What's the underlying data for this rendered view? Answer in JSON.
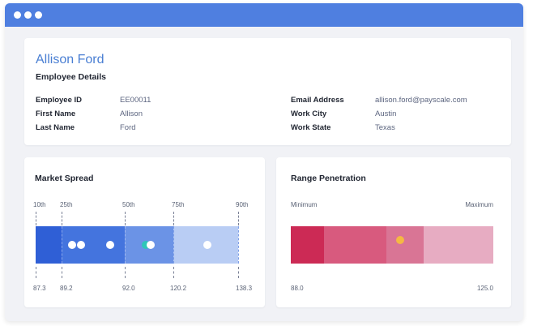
{
  "window": {
    "controls": [
      "dot",
      "dot",
      "dot"
    ]
  },
  "employee": {
    "name": "Allison Ford",
    "section_title": "Employee Details",
    "fields_left": [
      {
        "label": "Employee ID",
        "value": "EE00011"
      },
      {
        "label": "First Name",
        "value": "Allison"
      },
      {
        "label": "Last Name",
        "value": "Ford"
      }
    ],
    "fields_right": [
      {
        "label": "Email Address",
        "value": "allison.ford@payscale.com"
      },
      {
        "label": "Work City",
        "value": "Austin"
      },
      {
        "label": "Work State",
        "value": "Texas"
      }
    ]
  },
  "market_spread": {
    "title": "Market Spread",
    "percentile_labels": [
      "10th",
      "25th",
      "50th",
      "75th",
      "90th"
    ],
    "values": [
      "87.3",
      "89.2",
      "92.0",
      "120.2",
      "138.3"
    ],
    "colors": {
      "band_10_25": "#2f5fd6",
      "band_25_50": "#4474de",
      "band_50_75": "#6b93e6",
      "band_75_90": "#b9cdf4",
      "point_white": "#ffffff",
      "point_teal": "#2ec6b8"
    }
  },
  "range_penetration": {
    "title": "Range Penetration",
    "min_label": "Minimum",
    "max_label": "Maximum",
    "min_value": "88.0",
    "max_value": "125.0",
    "colors": {
      "band_1": "#cc2a55",
      "band_2": "#d85a7e",
      "band_3": "#d97595",
      "band_4": "#e7acc2",
      "marker": "#f5b843"
    }
  }
}
